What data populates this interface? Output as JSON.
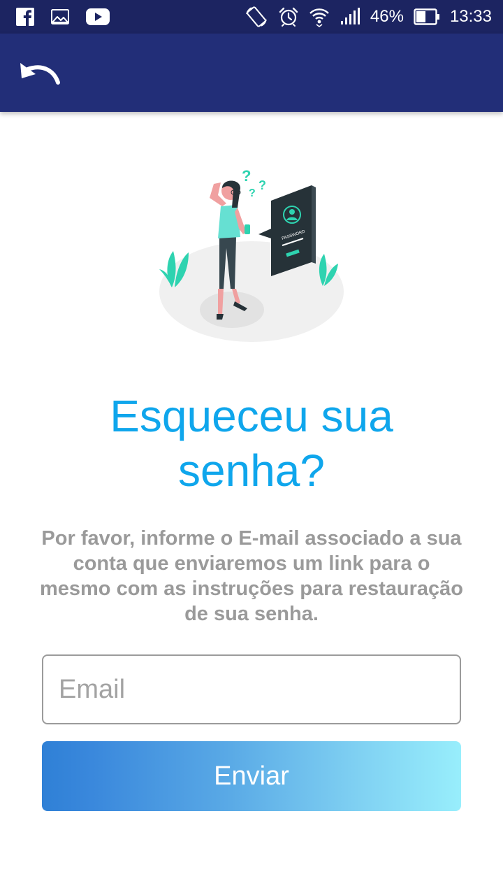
{
  "status_bar": {
    "battery_percent": "46%",
    "time": "13:33",
    "icons": [
      "facebook-icon",
      "gallery-icon",
      "youtube-icon",
      "rotate-icon",
      "alarm-icon",
      "wifi-icon",
      "signal-icon",
      "battery-icon"
    ]
  },
  "app_bar": {
    "back_icon": "undo-arrow-icon"
  },
  "illustration": {
    "password_label": "PASSWORD"
  },
  "title": "Esqueceu sua senha?",
  "description": "Por favor, informe o E-mail associado a sua conta que enviaremos um link para o mesmo com as instruções para restauração de sua senha.",
  "email": {
    "placeholder": "Email",
    "value": ""
  },
  "submit": {
    "label": "Enviar"
  },
  "colors": {
    "status_bar": "#1c2461",
    "app_bar": "#222e78",
    "title": "#0fa6ec",
    "description": "#9a9a9a",
    "button_gradient_start": "#2f80d6",
    "button_gradient_end": "#98eefc",
    "accent_teal": "#2ed3b0"
  }
}
